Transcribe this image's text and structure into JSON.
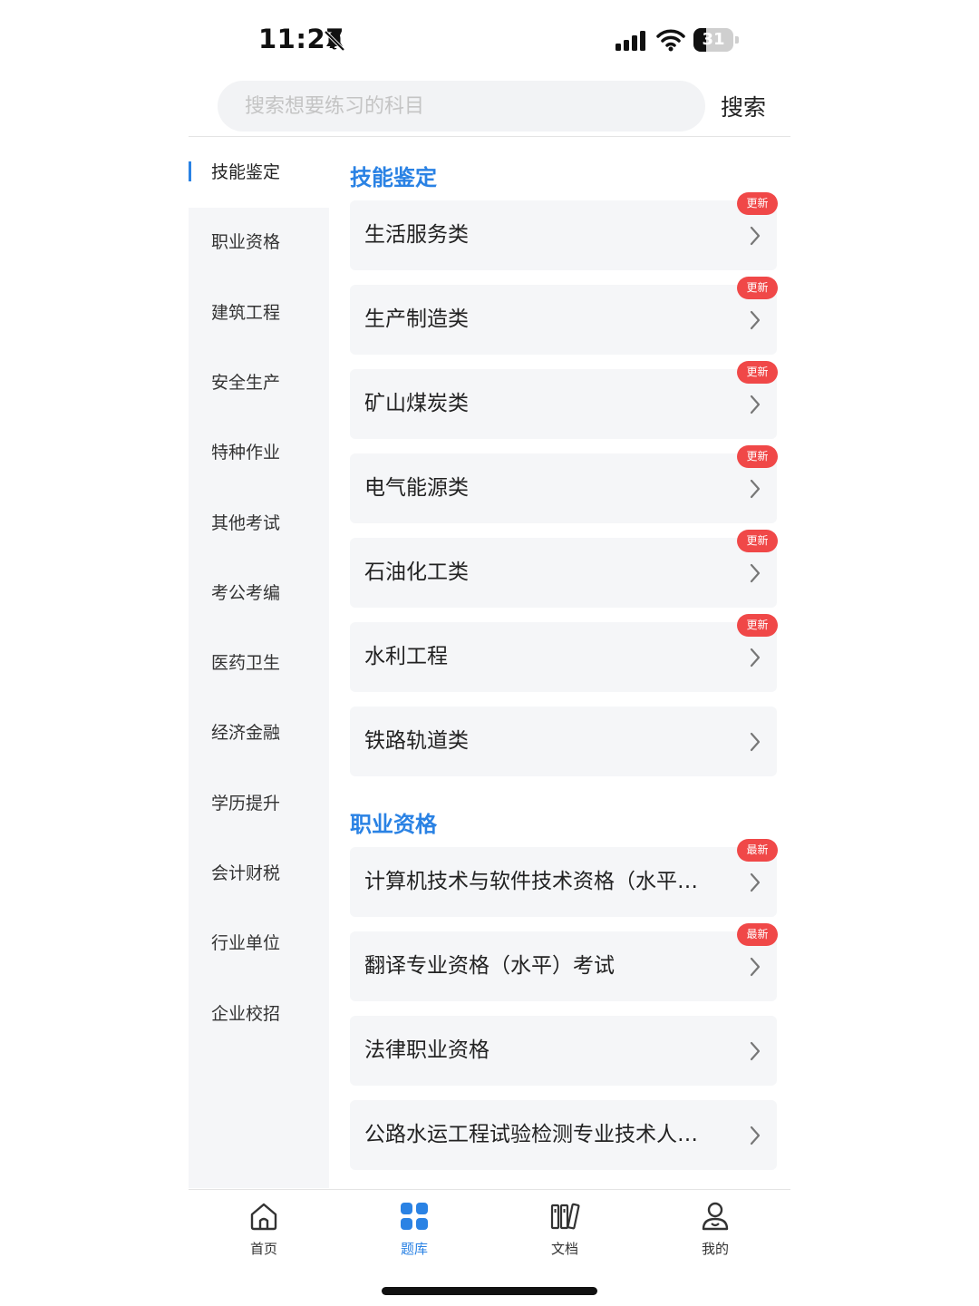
{
  "status_bar": {
    "time": "11:27",
    "battery": "31",
    "battery_level": 0.31
  },
  "search": {
    "placeholder": "搜索想要练习的科目",
    "button_label": "搜索"
  },
  "sidebar": {
    "items": [
      {
        "label": "技能鉴定",
        "active": true
      },
      {
        "label": "职业资格"
      },
      {
        "label": "建筑工程"
      },
      {
        "label": "安全生产"
      },
      {
        "label": "特种作业"
      },
      {
        "label": "其他考试"
      },
      {
        "label": "考公考编"
      },
      {
        "label": "医药卫生"
      },
      {
        "label": "经济金融"
      },
      {
        "label": "学历提升"
      },
      {
        "label": "会计财税"
      },
      {
        "label": "行业单位"
      },
      {
        "label": "企业校招"
      }
    ]
  },
  "sections": [
    {
      "title": "技能鉴定",
      "items": [
        {
          "label": "生活服务类",
          "badge": "更新"
        },
        {
          "label": "生产制造类",
          "badge": "更新"
        },
        {
          "label": "矿山煤炭类",
          "badge": "更新"
        },
        {
          "label": "电气能源类",
          "badge": "更新"
        },
        {
          "label": "石油化工类",
          "badge": "更新"
        },
        {
          "label": "水利工程",
          "badge": "更新"
        },
        {
          "label": "铁路轨道类",
          "badge": ""
        }
      ]
    },
    {
      "title": "职业资格",
      "items": [
        {
          "label": "计算机技术与软件技术资格（水平）考试",
          "badge": "最新"
        },
        {
          "label": "翻译专业资格（水平）考试",
          "badge": "最新"
        },
        {
          "label": "法律职业资格",
          "badge": ""
        },
        {
          "label": "公路水运工程试验检测专业技术人员职业资格",
          "badge": ""
        }
      ]
    }
  ],
  "tabbar": {
    "tabs": [
      {
        "label": "首页",
        "icon": "home-icon"
      },
      {
        "label": "题库",
        "icon": "grid-icon",
        "active": true
      },
      {
        "label": "文档",
        "icon": "document-icon"
      },
      {
        "label": "我的",
        "icon": "user-icon"
      }
    ]
  },
  "colors": {
    "accent": "#2a82e4",
    "badge": "#f04848",
    "card_bg": "#f5f6f8"
  }
}
